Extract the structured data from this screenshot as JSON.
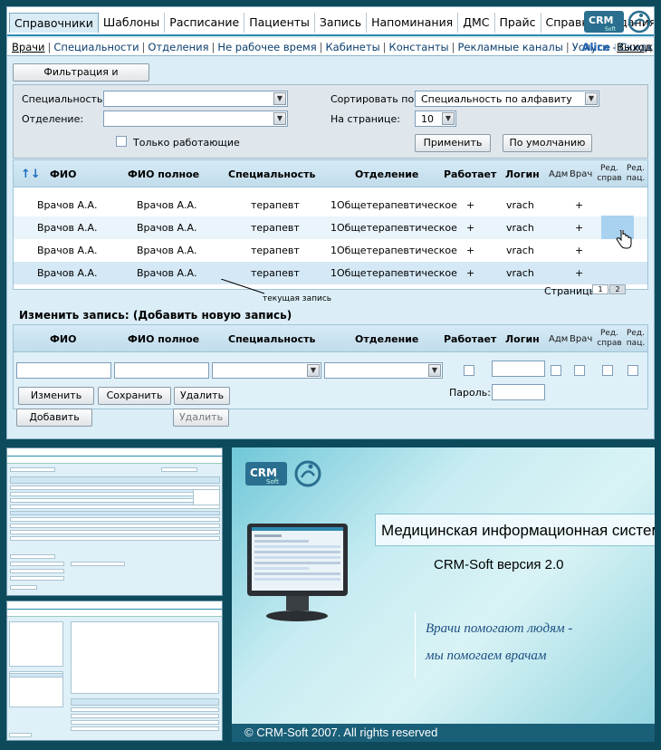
{
  "top_menu": [
    "Справочники",
    "Шаблоны",
    "Расписание",
    "Пациенты",
    "Запись",
    "Напоминания",
    "ДМС",
    "Прайс",
    "Справка",
    "Задания"
  ],
  "logo": {
    "text": "CRM",
    "sub": "Soft"
  },
  "sub_menu": [
    "Врачи",
    "Специальности",
    "Отделения",
    "Не рабочее время",
    "Кабинеты",
    "Константы",
    "Рекламные каналы",
    "Услуги - Скидки"
  ],
  "user": "Alice",
  "exit": "Выход",
  "filter_button": "Фильтрация и сортировка",
  "filter": {
    "specialty_label": "Специальность:",
    "department_label": "Отделение:",
    "only_working_label": "Только работающие",
    "sort_label": "Сортировать по:",
    "sort_value": "Специальность по алфавиту",
    "per_page_label": "На странице:",
    "per_page_value": "10",
    "apply": "Применить",
    "default": "По умолчанию"
  },
  "table": {
    "sort_icon": "↑↓",
    "headers": {
      "fio": "ФИО",
      "fio_full": "ФИО полное",
      "specialty": "Специальность",
      "department": "Отделение",
      "working": "Работает",
      "login": "Логин",
      "adm": "Адм",
      "doctor": "Врач",
      "edit_ref_1": "Ред.",
      "edit_ref_2": "справ",
      "edit_pat_1": "Ред.",
      "edit_pat_2": "пац."
    },
    "rows": [
      {
        "fio": "Врачов А.А.",
        "fio_full": "Врачов А.А.",
        "specialty": "терапевт",
        "department": "1Общетерапевтическое",
        "working": "+",
        "login": "vrach",
        "doctor": "+"
      },
      {
        "fio": "Врачов А.А.",
        "fio_full": "Врачов А.А.",
        "specialty": "терапевт",
        "department": "1Общетерапевтическое",
        "working": "+",
        "login": "vrach",
        "doctor": "+"
      },
      {
        "fio": "Врачов А.А.",
        "fio_full": "Врачов А.А.",
        "specialty": "терапевт",
        "department": "1Общетерапевтическое",
        "working": "+",
        "login": "vrach",
        "doctor": "+"
      },
      {
        "fio": "Врачов А.А.",
        "fio_full": "Врачов А.А.",
        "specialty": "терапевт",
        "department": "1Общетерапевтическое",
        "working": "+",
        "login": "vrach",
        "doctor": "+"
      }
    ],
    "current_record_note": "текущая запись",
    "pages_label": "Страницы",
    "pages": [
      "1",
      "2"
    ]
  },
  "edit": {
    "title": "Изменить запись: (Добавить новую запись)",
    "password_label": "Пароль:",
    "change": "Изменить",
    "save": "Сохранить",
    "delete": "Удалить",
    "add": "Добавить",
    "delete2": "Удалить"
  },
  "promo": {
    "title": "Медицинская информационная система",
    "version": "CRM-Soft   версия 2.0",
    "slogan_1": "Врачи помогают людям -",
    "slogan_2": "мы помогаем врачам",
    "footer": "© CRM-Soft 2007. All rights reserved"
  },
  "colors": {
    "accent": "#2e8ab0",
    "footer": "#1a5f78",
    "background": "#0d4a5c"
  }
}
